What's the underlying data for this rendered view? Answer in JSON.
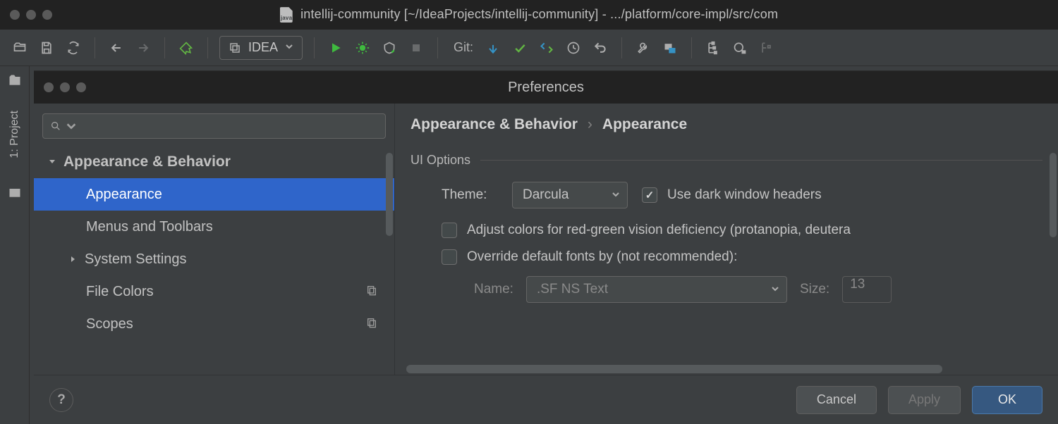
{
  "main_window": {
    "title": "intellij-community [~/IdeaProjects/intellij-community] - .../platform/core-impl/src/com"
  },
  "toolbar": {
    "run_config": "IDEA",
    "git_label": "Git:"
  },
  "gutter": {
    "project_label": "1: Project"
  },
  "prefs": {
    "title": "Preferences",
    "breadcrumb": {
      "a": "Appearance & Behavior",
      "b": "Appearance"
    },
    "tree": {
      "root": "Appearance & Behavior",
      "items": [
        {
          "label": "Appearance",
          "selected": true
        },
        {
          "label": "Menus and Toolbars"
        },
        {
          "label": "System Settings",
          "expandable": true
        },
        {
          "label": "File Colors",
          "shared": true
        },
        {
          "label": "Scopes",
          "shared": true
        }
      ]
    },
    "content": {
      "section": "UI Options",
      "theme_label": "Theme:",
      "theme_value": "Darcula",
      "dark_headers": "Use dark window headers",
      "color_adjust": "Adjust colors for red-green vision deficiency (protanopia, deutera",
      "override_fonts": "Override default fonts by (not recommended):",
      "font_name_label": "Name:",
      "font_name_value": ".SF NS Text",
      "font_size_label": "Size:",
      "font_size_value": "13"
    },
    "footer": {
      "cancel": "Cancel",
      "apply": "Apply",
      "ok": "OK"
    }
  }
}
